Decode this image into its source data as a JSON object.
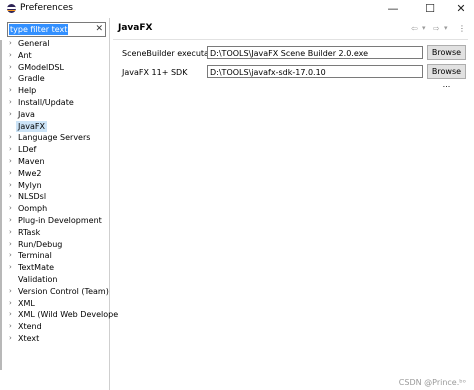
{
  "window": {
    "title": "Preferences",
    "minimize_glyph": "—",
    "maximize_glyph": "☐",
    "close_glyph": "✕"
  },
  "filter": {
    "value": "type filter text",
    "clear_glyph": "✕"
  },
  "tree": {
    "items": [
      {
        "label": "General",
        "arrow": "›",
        "selected": false
      },
      {
        "label": "Ant",
        "arrow": "›",
        "selected": false
      },
      {
        "label": "GModelDSL",
        "arrow": "›",
        "selected": false
      },
      {
        "label": "Gradle",
        "arrow": "›",
        "selected": false
      },
      {
        "label": "Help",
        "arrow": "›",
        "selected": false
      },
      {
        "label": "Install/Update",
        "arrow": "›",
        "selected": false
      },
      {
        "label": "Java",
        "arrow": "›",
        "selected": false
      },
      {
        "label": "JavaFX",
        "arrow": "",
        "selected": true
      },
      {
        "label": "Language Servers",
        "arrow": "›",
        "selected": false
      },
      {
        "label": "LDef",
        "arrow": "›",
        "selected": false
      },
      {
        "label": "Maven",
        "arrow": "›",
        "selected": false
      },
      {
        "label": "Mwe2",
        "arrow": "›",
        "selected": false
      },
      {
        "label": "Mylyn",
        "arrow": "›",
        "selected": false
      },
      {
        "label": "NLSDsl",
        "arrow": "›",
        "selected": false
      },
      {
        "label": "Oomph",
        "arrow": "›",
        "selected": false
      },
      {
        "label": "Plug-in Development",
        "arrow": "›",
        "selected": false
      },
      {
        "label": "RTask",
        "arrow": "›",
        "selected": false
      },
      {
        "label": "Run/Debug",
        "arrow": "›",
        "selected": false
      },
      {
        "label": "Terminal",
        "arrow": "›",
        "selected": false
      },
      {
        "label": "TextMate",
        "arrow": "›",
        "selected": false
      },
      {
        "label": "Validation",
        "arrow": "",
        "selected": false
      },
      {
        "label": "Version Control (Team)",
        "arrow": "›",
        "selected": false
      },
      {
        "label": "XML",
        "arrow": "›",
        "selected": false
      },
      {
        "label": "XML (Wild Web Develope",
        "arrow": "›",
        "selected": false
      },
      {
        "label": "Xtend",
        "arrow": "›",
        "selected": false
      },
      {
        "label": "Xtext",
        "arrow": "›",
        "selected": false
      }
    ]
  },
  "page": {
    "title": "JavaFX",
    "nav": {
      "back_glyph": "⇦",
      "back_menu_glyph": "▾",
      "forward_glyph": "⇨",
      "forward_menu_glyph": "▾",
      "more_glyph": "⋮"
    },
    "fields": [
      {
        "label": "SceneBuilder executable",
        "value": "D:\\TOOLS\\JavaFX Scene Builder 2.0.exe",
        "button": "Browse ..."
      },
      {
        "label": "JavaFX 11+ SDK",
        "value": "D:\\TOOLS\\javafx-sdk-17.0.10",
        "button": "Browse ..."
      }
    ]
  },
  "watermark": "CSDN @Prince.ᵇᵒ"
}
